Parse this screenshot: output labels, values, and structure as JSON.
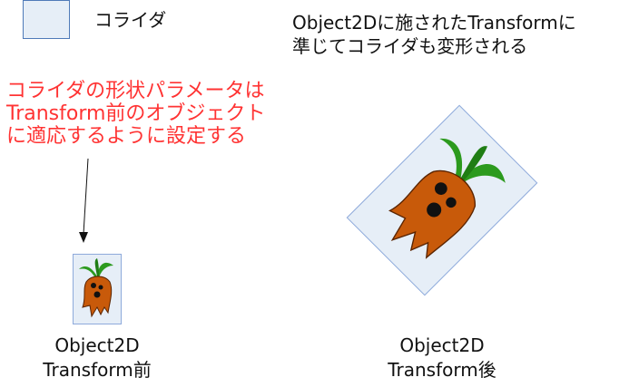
{
  "legend": {
    "label": "コライダ",
    "collider_color": "#e6eef7",
    "collider_border": "#4f7ab8"
  },
  "note_red": {
    "lines": [
      "コライダの形状パラメータは",
      "Transform前のオブジェクト",
      "に適応するように設定する"
    ],
    "color": "#ff3333"
  },
  "note_right": {
    "lines": [
      "Object2Dに施されたTransformに",
      "準じてコライダも変形される"
    ]
  },
  "before": {
    "lines": [
      "Object2D",
      "Transform前"
    ]
  },
  "after": {
    "lines": [
      "Object2D",
      "Transform後"
    ]
  }
}
